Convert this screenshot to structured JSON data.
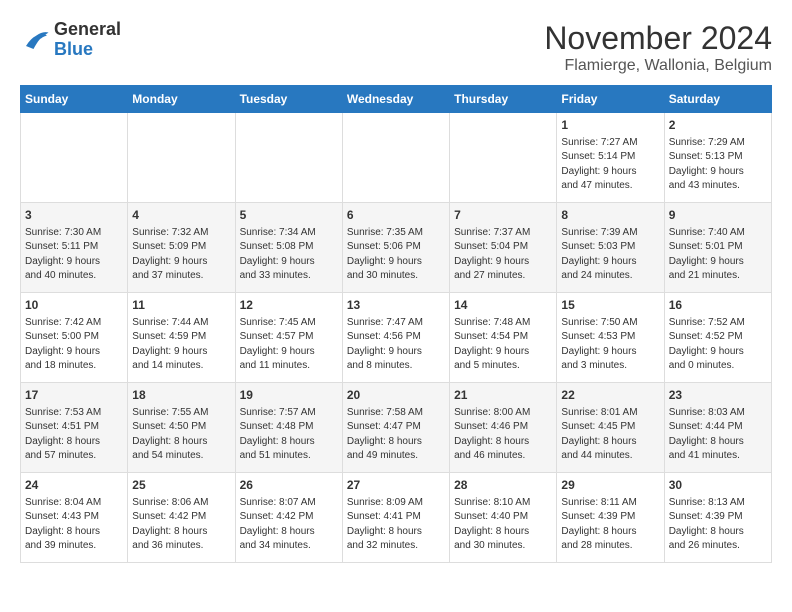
{
  "logo": {
    "general": "General",
    "blue": "Blue"
  },
  "title": "November 2024",
  "subtitle": "Flamierge, Wallonia, Belgium",
  "days_of_week": [
    "Sunday",
    "Monday",
    "Tuesday",
    "Wednesday",
    "Thursday",
    "Friday",
    "Saturday"
  ],
  "weeks": [
    [
      {
        "day": "",
        "info": ""
      },
      {
        "day": "",
        "info": ""
      },
      {
        "day": "",
        "info": ""
      },
      {
        "day": "",
        "info": ""
      },
      {
        "day": "",
        "info": ""
      },
      {
        "day": "1",
        "info": "Sunrise: 7:27 AM\nSunset: 5:14 PM\nDaylight: 9 hours\nand 47 minutes."
      },
      {
        "day": "2",
        "info": "Sunrise: 7:29 AM\nSunset: 5:13 PM\nDaylight: 9 hours\nand 43 minutes."
      }
    ],
    [
      {
        "day": "3",
        "info": "Sunrise: 7:30 AM\nSunset: 5:11 PM\nDaylight: 9 hours\nand 40 minutes."
      },
      {
        "day": "4",
        "info": "Sunrise: 7:32 AM\nSunset: 5:09 PM\nDaylight: 9 hours\nand 37 minutes."
      },
      {
        "day": "5",
        "info": "Sunrise: 7:34 AM\nSunset: 5:08 PM\nDaylight: 9 hours\nand 33 minutes."
      },
      {
        "day": "6",
        "info": "Sunrise: 7:35 AM\nSunset: 5:06 PM\nDaylight: 9 hours\nand 30 minutes."
      },
      {
        "day": "7",
        "info": "Sunrise: 7:37 AM\nSunset: 5:04 PM\nDaylight: 9 hours\nand 27 minutes."
      },
      {
        "day": "8",
        "info": "Sunrise: 7:39 AM\nSunset: 5:03 PM\nDaylight: 9 hours\nand 24 minutes."
      },
      {
        "day": "9",
        "info": "Sunrise: 7:40 AM\nSunset: 5:01 PM\nDaylight: 9 hours\nand 21 minutes."
      }
    ],
    [
      {
        "day": "10",
        "info": "Sunrise: 7:42 AM\nSunset: 5:00 PM\nDaylight: 9 hours\nand 18 minutes."
      },
      {
        "day": "11",
        "info": "Sunrise: 7:44 AM\nSunset: 4:59 PM\nDaylight: 9 hours\nand 14 minutes."
      },
      {
        "day": "12",
        "info": "Sunrise: 7:45 AM\nSunset: 4:57 PM\nDaylight: 9 hours\nand 11 minutes."
      },
      {
        "day": "13",
        "info": "Sunrise: 7:47 AM\nSunset: 4:56 PM\nDaylight: 9 hours\nand 8 minutes."
      },
      {
        "day": "14",
        "info": "Sunrise: 7:48 AM\nSunset: 4:54 PM\nDaylight: 9 hours\nand 5 minutes."
      },
      {
        "day": "15",
        "info": "Sunrise: 7:50 AM\nSunset: 4:53 PM\nDaylight: 9 hours\nand 3 minutes."
      },
      {
        "day": "16",
        "info": "Sunrise: 7:52 AM\nSunset: 4:52 PM\nDaylight: 9 hours\nand 0 minutes."
      }
    ],
    [
      {
        "day": "17",
        "info": "Sunrise: 7:53 AM\nSunset: 4:51 PM\nDaylight: 8 hours\nand 57 minutes."
      },
      {
        "day": "18",
        "info": "Sunrise: 7:55 AM\nSunset: 4:50 PM\nDaylight: 8 hours\nand 54 minutes."
      },
      {
        "day": "19",
        "info": "Sunrise: 7:57 AM\nSunset: 4:48 PM\nDaylight: 8 hours\nand 51 minutes."
      },
      {
        "day": "20",
        "info": "Sunrise: 7:58 AM\nSunset: 4:47 PM\nDaylight: 8 hours\nand 49 minutes."
      },
      {
        "day": "21",
        "info": "Sunrise: 8:00 AM\nSunset: 4:46 PM\nDaylight: 8 hours\nand 46 minutes."
      },
      {
        "day": "22",
        "info": "Sunrise: 8:01 AM\nSunset: 4:45 PM\nDaylight: 8 hours\nand 44 minutes."
      },
      {
        "day": "23",
        "info": "Sunrise: 8:03 AM\nSunset: 4:44 PM\nDaylight: 8 hours\nand 41 minutes."
      }
    ],
    [
      {
        "day": "24",
        "info": "Sunrise: 8:04 AM\nSunset: 4:43 PM\nDaylight: 8 hours\nand 39 minutes."
      },
      {
        "day": "25",
        "info": "Sunrise: 8:06 AM\nSunset: 4:42 PM\nDaylight: 8 hours\nand 36 minutes."
      },
      {
        "day": "26",
        "info": "Sunrise: 8:07 AM\nSunset: 4:42 PM\nDaylight: 8 hours\nand 34 minutes."
      },
      {
        "day": "27",
        "info": "Sunrise: 8:09 AM\nSunset: 4:41 PM\nDaylight: 8 hours\nand 32 minutes."
      },
      {
        "day": "28",
        "info": "Sunrise: 8:10 AM\nSunset: 4:40 PM\nDaylight: 8 hours\nand 30 minutes."
      },
      {
        "day": "29",
        "info": "Sunrise: 8:11 AM\nSunset: 4:39 PM\nDaylight: 8 hours\nand 28 minutes."
      },
      {
        "day": "30",
        "info": "Sunrise: 8:13 AM\nSunset: 4:39 PM\nDaylight: 8 hours\nand 26 minutes."
      }
    ]
  ]
}
